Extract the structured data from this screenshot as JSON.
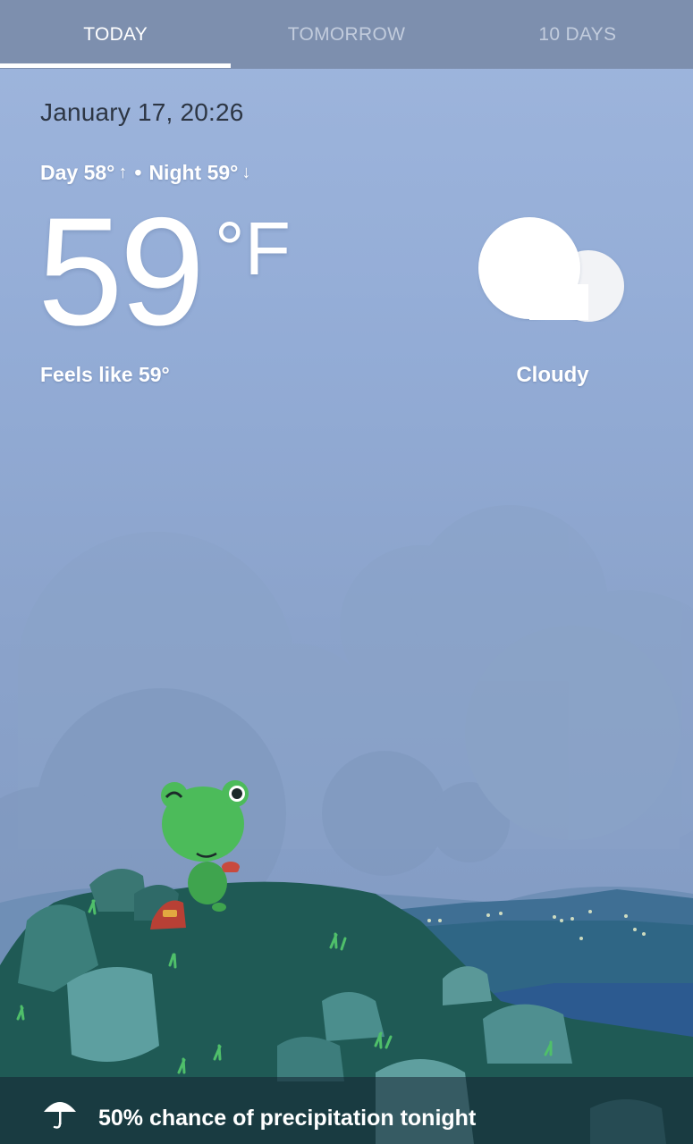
{
  "tabs": [
    {
      "label": "TODAY",
      "active": true
    },
    {
      "label": "TOMORROW",
      "active": false
    },
    {
      "label": "10 DAYS",
      "active": false
    }
  ],
  "current": {
    "datetime": "January 17, 20:26",
    "day_label": "Day 58°",
    "day_arrow": "↑",
    "separator": "•",
    "night_label": "Night 59°",
    "night_arrow": "↓",
    "temperature": "59",
    "unit": "°F",
    "feels_like": "Feels like 59°",
    "condition": "Cloudy",
    "condition_icon": "cloud-icon"
  },
  "footer": {
    "icon": "umbrella-icon",
    "precipitation": "50% chance of precipitation tonight"
  },
  "colors": {
    "tab_bar": "#7d8fae",
    "sky_top": "#9fb6dd",
    "sky_bottom": "#7e97bf",
    "date_text": "#2d3644",
    "frog": "#4cbb5a"
  }
}
